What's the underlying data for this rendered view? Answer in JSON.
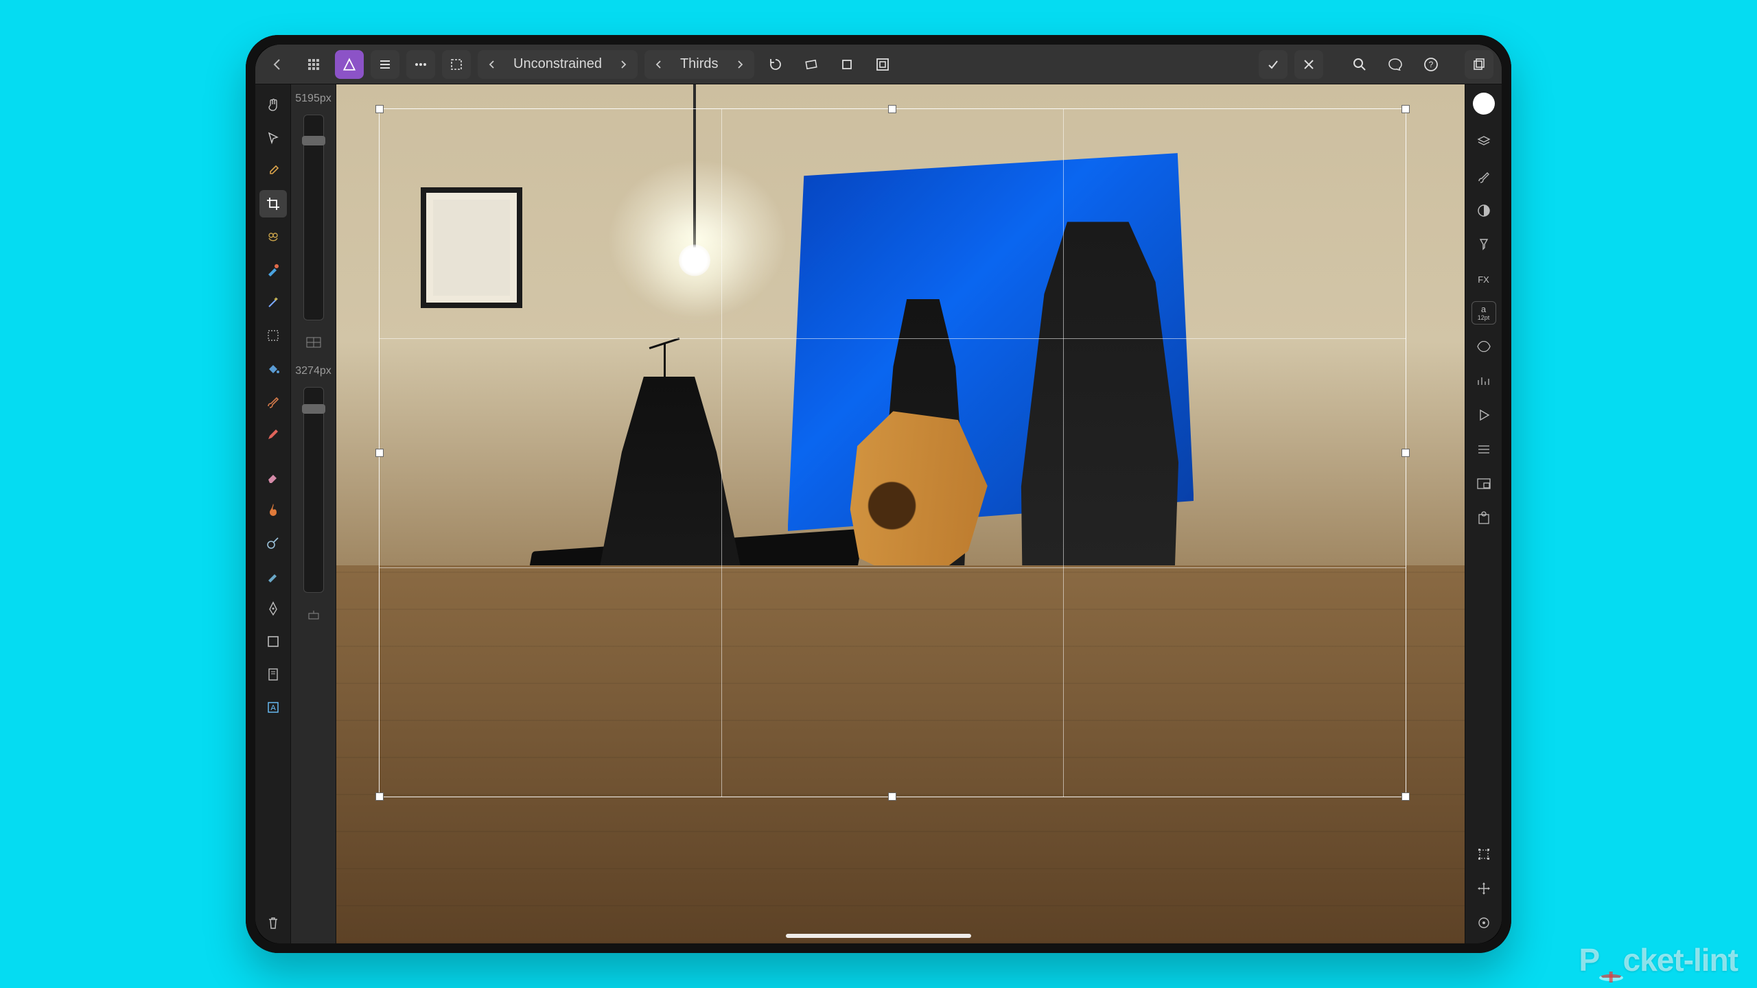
{
  "watermark": "Pocket-lint",
  "topbar": {
    "ratio": {
      "label": "Unconstrained"
    },
    "overlay": {
      "label": "Thirds"
    }
  },
  "crop": {
    "width_label": "5195px",
    "height_label": "3274px"
  },
  "right_panel": {
    "fx_label": "FX",
    "pt_label_top": "a",
    "pt_label_bottom": "12pt"
  },
  "colors": {
    "accent": "#8c53c7",
    "background": "#05dcf2"
  },
  "icons": {
    "back": "back-icon",
    "grid": "grid-icon",
    "persona": "persona-icon",
    "menu": "menu-icon",
    "more": "more-icon",
    "marquee": "marquee-icon",
    "chev_left": "chevron-left-icon",
    "chev_right": "chevron-right-icon",
    "rotate": "rotate-icon",
    "straighten": "straighten-icon",
    "crop": "crop-icon",
    "canvas": "canvas-clip-icon",
    "apply": "check-icon",
    "cancel": "close-icon",
    "zoom": "magnifier-icon",
    "assistant": "palette-icon",
    "help": "help-icon",
    "documents": "documents-icon",
    "hand": "hand-icon",
    "move": "move-icon",
    "color_picker": "eyedropper-icon",
    "crop_tool": "crop-tool-icon",
    "owl": "owl-icon",
    "heal": "heal-brush-icon",
    "wand": "magic-wand-icon",
    "select": "selection-icon",
    "fill": "flood-fill-icon",
    "brush": "paint-brush-icon",
    "pencil": "pencil-icon",
    "erase": "eraser-icon",
    "burn": "burn-icon",
    "dodge": "dodge-icon",
    "smudge": "smudge-icon",
    "pen": "pen-icon",
    "shape": "shape-icon",
    "book": "text-frame-icon",
    "text": "artistic-text-icon",
    "trash": "trash-icon",
    "overlay_toggle": "overlay-cycle-icon",
    "slider_snap": "snap-icon",
    "white_circle": "current-color-swatch",
    "layers": "layers-icon",
    "brush_r": "brushes-icon",
    "adjust": "adjustments-icon",
    "hourglass": "live-filters-icon",
    "styles": "styles-icon",
    "channels": "channels-icon",
    "stock": "stock-icon",
    "macros": "macros-icon",
    "history": "history-icon",
    "export": "export-icon",
    "transform": "transform-icon",
    "nudge": "nudge-icon",
    "snapping": "snapping-icon"
  }
}
